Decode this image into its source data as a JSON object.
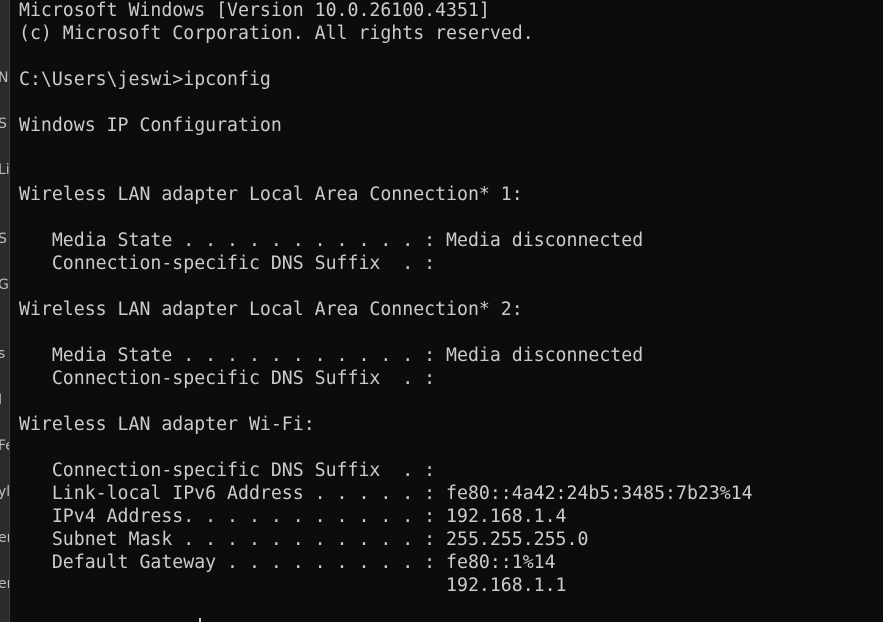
{
  "sidebar_fragments": [
    "N",
    "S",
    "Li",
    "S",
    "G",
    "s",
    "I",
    "Fe",
    "yl",
    "er",
    "er"
  ],
  "terminal": {
    "lines": [
      "Microsoft Windows [Version 10.0.26100.4351]",
      "(c) Microsoft Corporation. All rights reserved.",
      "",
      "C:\\Users\\jeswi>ipconfig",
      "",
      "Windows IP Configuration",
      "",
      "",
      "Wireless LAN adapter Local Area Connection* 1:",
      "",
      "   Media State . . . . . . . . . . . : Media disconnected",
      "   Connection-specific DNS Suffix  . :",
      "",
      "Wireless LAN adapter Local Area Connection* 2:",
      "",
      "   Media State . . . . . . . . . . . : Media disconnected",
      "   Connection-specific DNS Suffix  . :",
      "",
      "Wireless LAN adapter Wi-Fi:",
      "",
      "   Connection-specific DNS Suffix  . :",
      "   Link-local IPv6 Address . . . . . : fe80::4a42:24b5:3485:7b23%14",
      "   IPv4 Address. . . . . . . . . . . : 192.168.1.4",
      "   Subnet Mask . . . . . . . . . . . : 255.255.255.0",
      "   Default Gateway . . . . . . . . . : fe80::1%14",
      "                                       192.168.1.1"
    ]
  },
  "colors": {
    "background": "#0c0c0c",
    "foreground": "#cccccc"
  }
}
